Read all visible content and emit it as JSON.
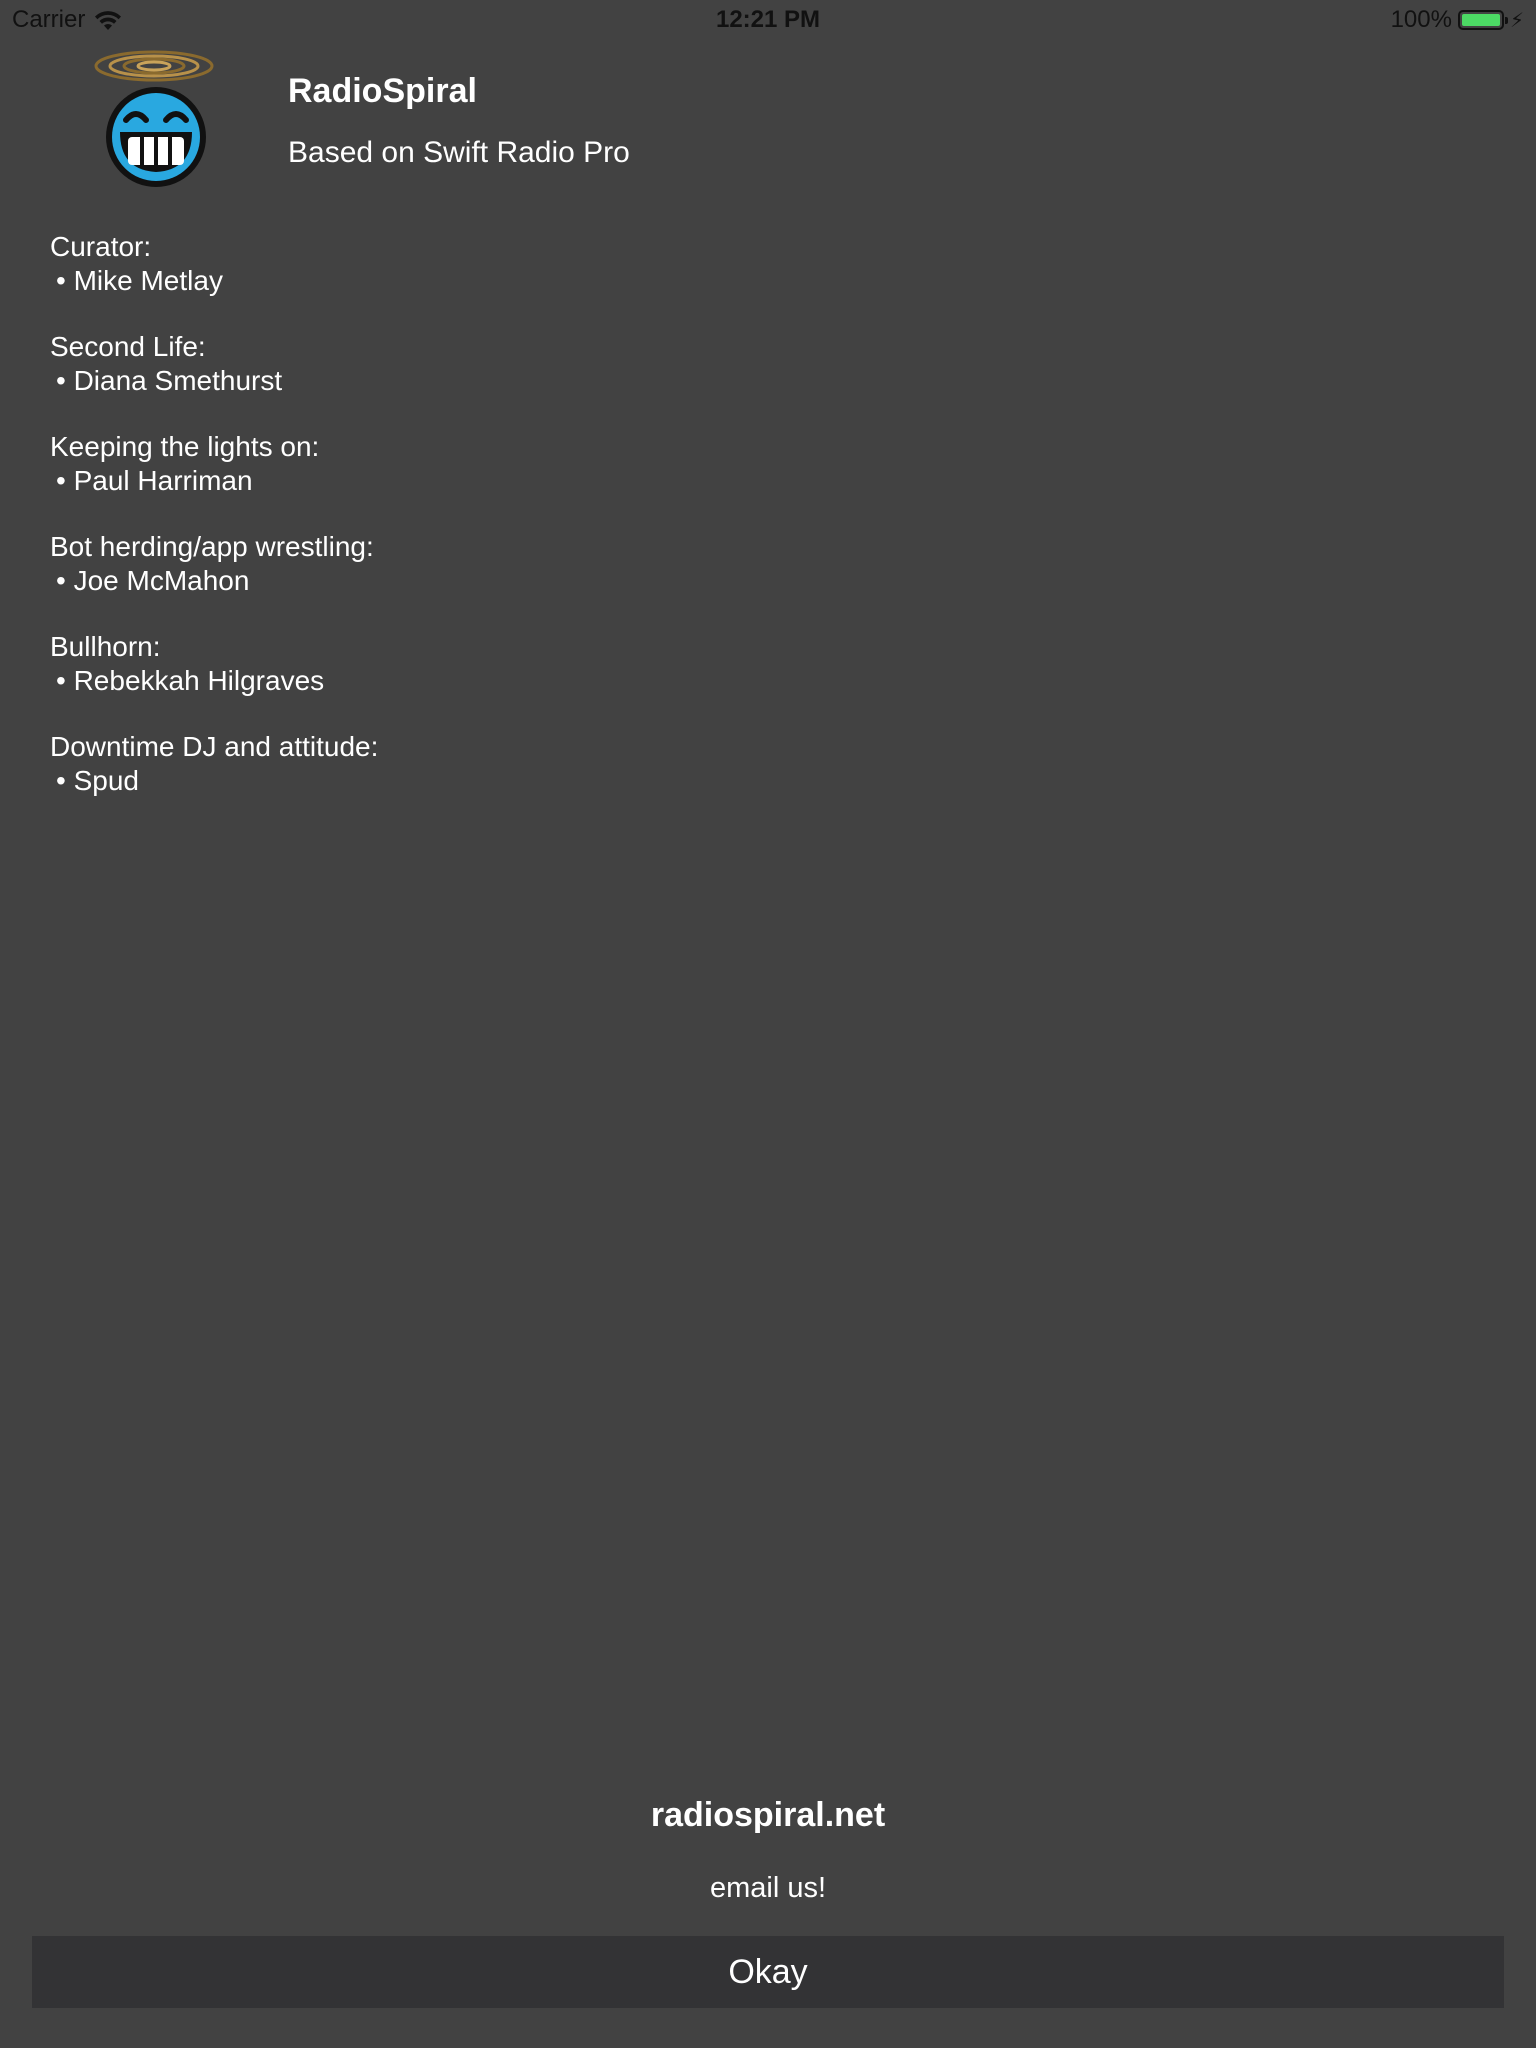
{
  "status_bar": {
    "carrier": "Carrier",
    "time": "12:21 PM",
    "battery": "100%",
    "icons": [
      "wifi-icon",
      "battery-icon",
      "charging-bolt-icon"
    ],
    "battery_color": "#4cd964"
  },
  "header": {
    "logo_icon": "radiospiral-logo-grinning-face-with-spiral-halo",
    "title": "RadioSpiral",
    "subtitle": "Based on Swift Radio Pro"
  },
  "credits": [
    {
      "role": "Curator:",
      "name": "• Mike Metlay"
    },
    {
      "role": "Second Life:",
      "name": "• Diana Smethurst"
    },
    {
      "role": "Keeping the lights on:",
      "name": "• Paul Harriman"
    },
    {
      "role": "Bot herding/app wrestling:",
      "name": "• Joe McMahon"
    },
    {
      "role": "Bullhorn:",
      "name": "• Rebekkah Hilgraves"
    },
    {
      "role": "Downtime DJ and attitude:",
      "name": "• Spud"
    }
  ],
  "footer": {
    "website": "radiospiral.net",
    "email": "email us!",
    "okay_label": "Okay"
  },
  "colors": {
    "background": "#424242",
    "button_background": "#333335",
    "text": "#ffffff"
  }
}
